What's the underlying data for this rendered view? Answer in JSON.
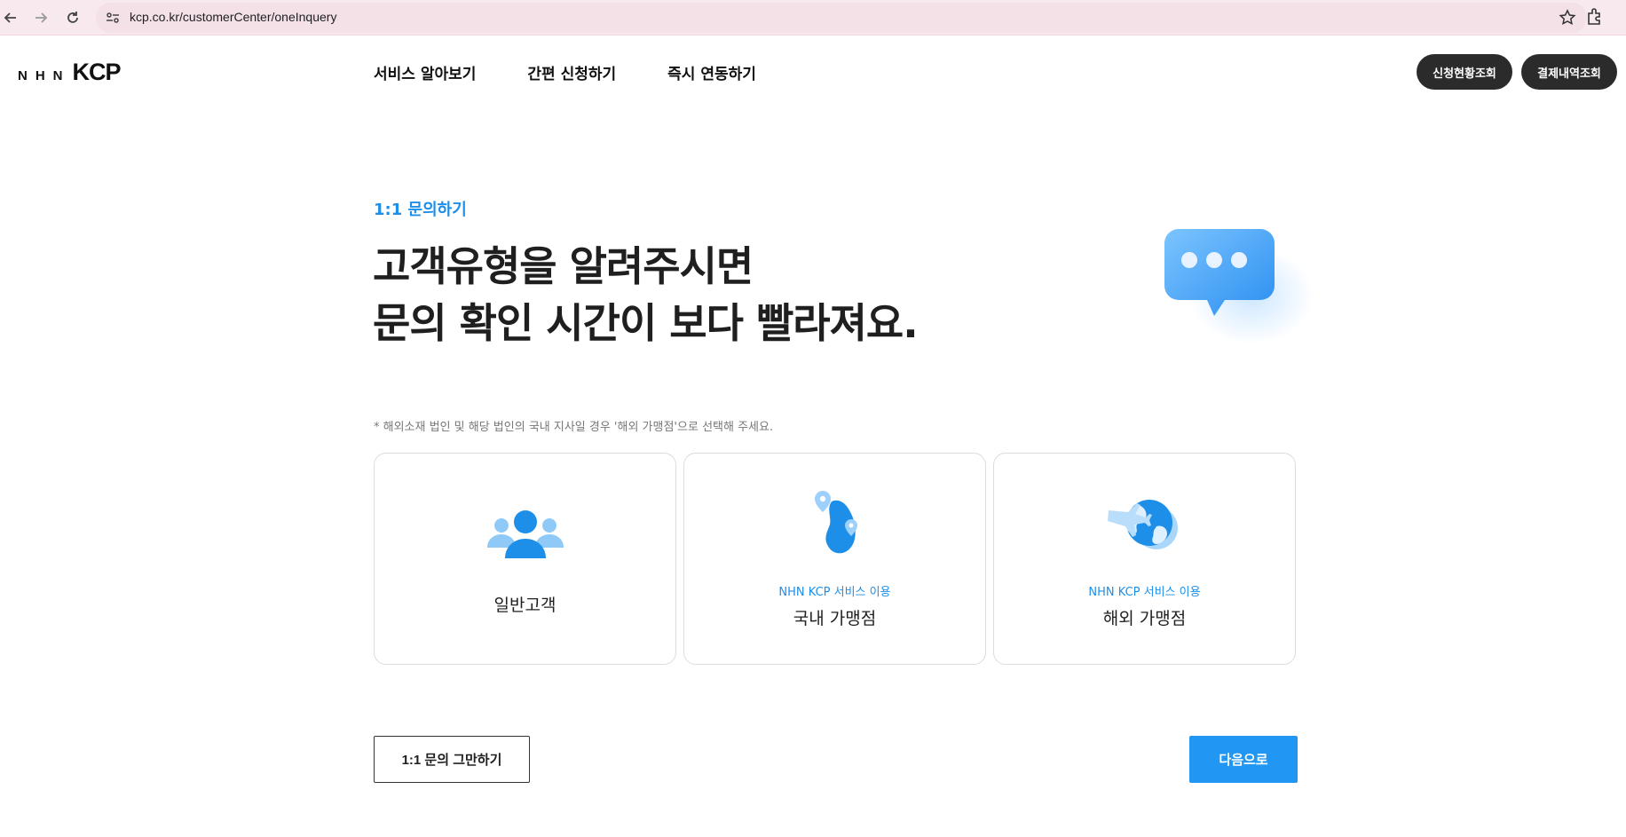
{
  "browser": {
    "url": "kcp.co.kr/customerCenter/oneInquery",
    "icons": [
      "back-icon",
      "forward-icon",
      "reload-icon",
      "site-info-icon",
      "star-icon",
      "extensions-icon"
    ]
  },
  "header": {
    "logo_nhn": "NHN",
    "logo_kcp": "KCP",
    "nav": [
      "서비스 알아보기",
      "간편 신청하기",
      "즉시 연동하기"
    ],
    "btn_status": "신청현황조회",
    "btn_payment": "결제내역조회"
  },
  "hero": {
    "eyebrow": "1:1 문의하기",
    "line1": "고객유형을 알려주시면",
    "line2": "문의 확인 시간이 보다 빨라져요."
  },
  "note": "* 해외소재 법인 및 해당 법인의 국내 지사일 경우 '해외 가맹점'으로 선택해 주세요.",
  "cards": [
    {
      "title": "일반고객",
      "icon": "people-icon"
    },
    {
      "sub": "NHN KCP 서비스 이용",
      "title": "국내 가맹점",
      "icon": "korea-map-pin-icon"
    },
    {
      "sub": "NHN KCP 서비스 이용",
      "title": "해외 가맹점",
      "icon": "globe-airplane-icon"
    }
  ],
  "buttons": {
    "cancel": "1:1 문의 그만하기",
    "next": "다음으로"
  },
  "colors": {
    "accent": "#1e8fe8",
    "button_blue": "#2196f3",
    "dark_button": "#2b2b2b",
    "browser_bar": "#f7e9ee"
  }
}
